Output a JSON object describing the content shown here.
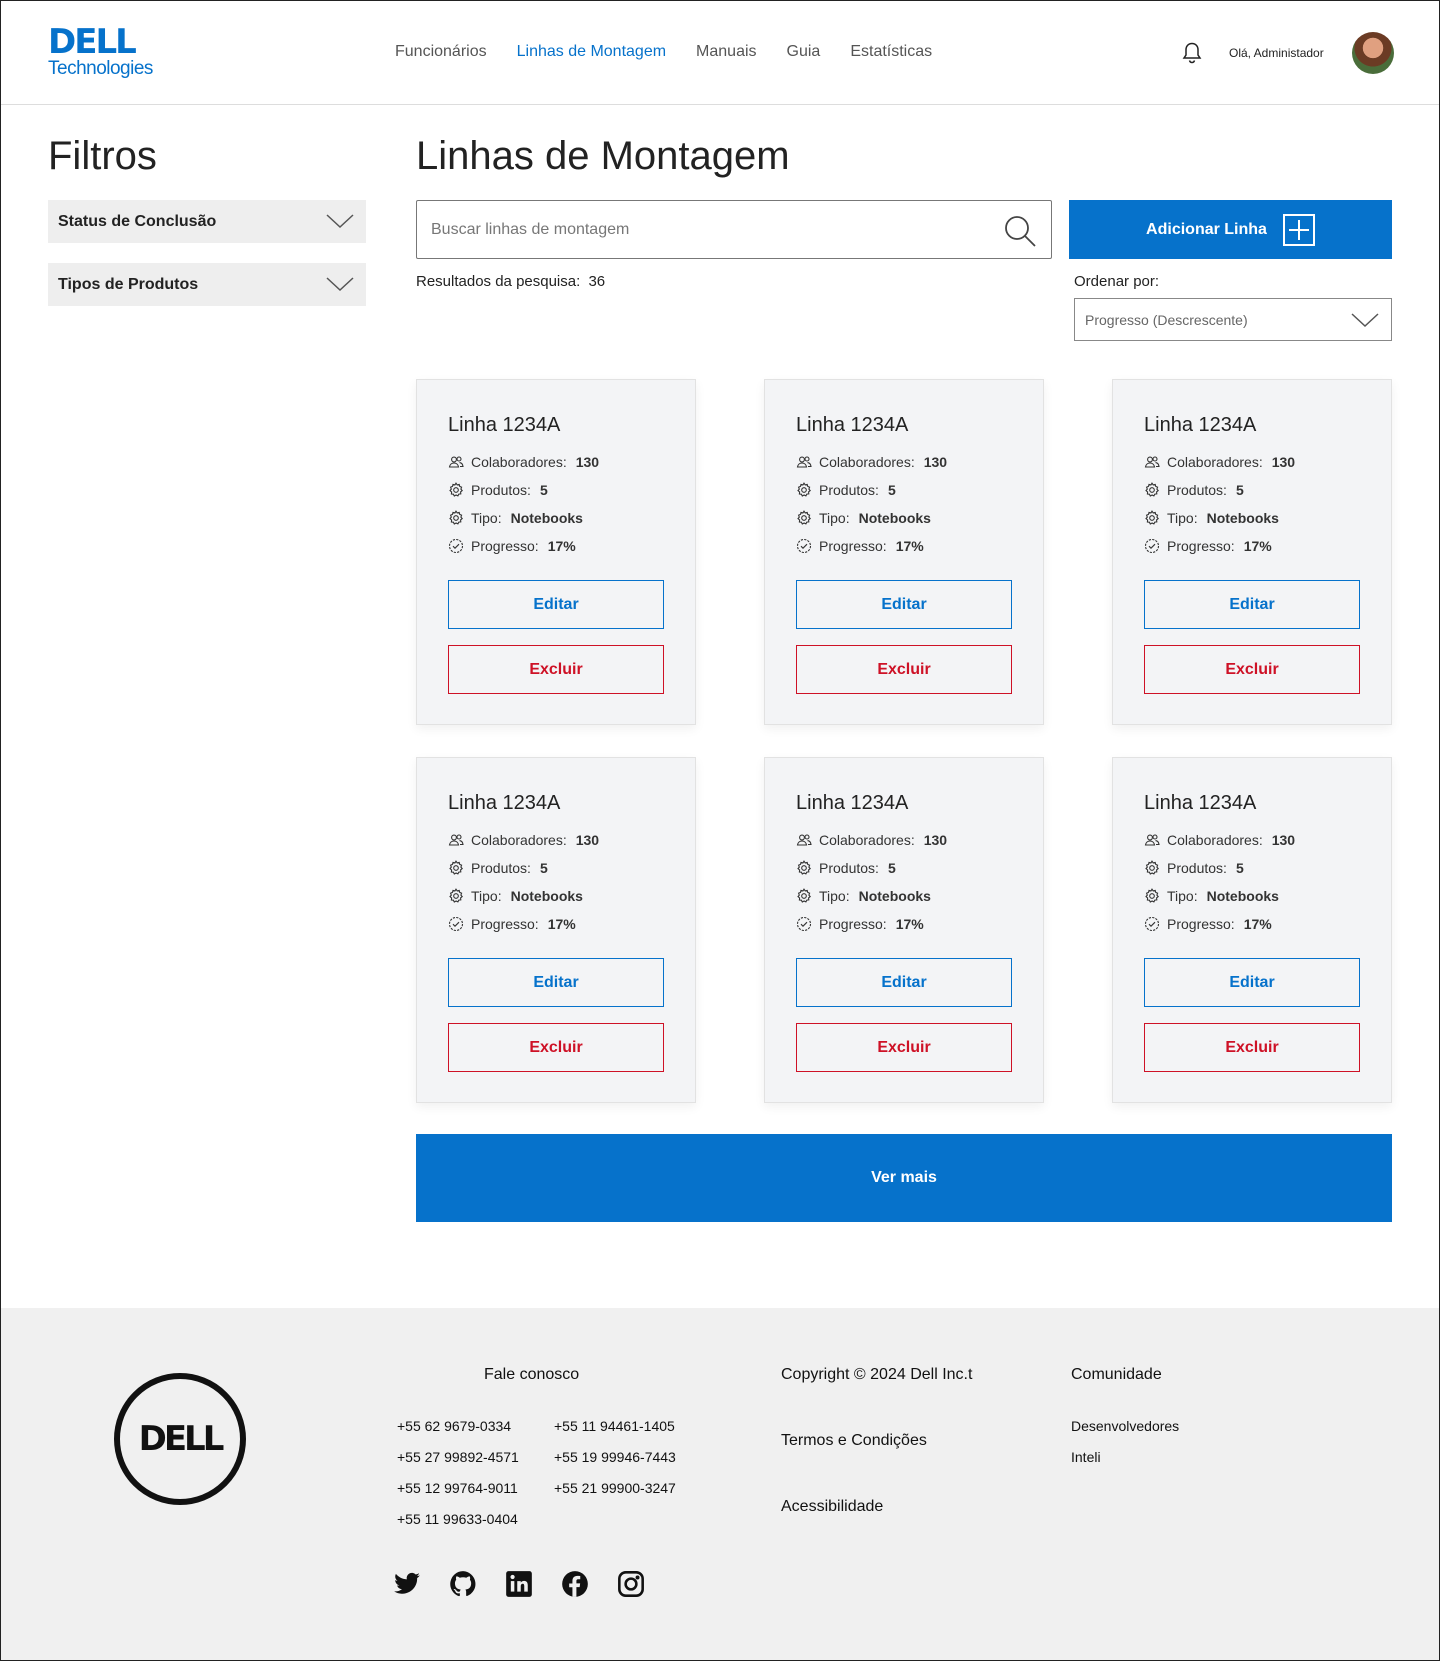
{
  "header": {
    "logo_main": "DELL",
    "logo_sub": "Technologies",
    "nav": [
      {
        "label": "Funcionários",
        "active": false
      },
      {
        "label": "Linhas de Montagem",
        "active": true
      },
      {
        "label": "Manuais",
        "active": false
      },
      {
        "label": "Guia",
        "active": false
      },
      {
        "label": "Estatísticas",
        "active": false
      }
    ],
    "greeting": "Olá, Administador"
  },
  "sidebar": {
    "title": "Filtros",
    "filters": [
      {
        "label": "Status de Conclusão"
      },
      {
        "label": "Tipos de Produtos"
      }
    ]
  },
  "main": {
    "title": "Linhas de Montagem",
    "search_placeholder": "Buscar linhas de montagem",
    "add_button": "Adicionar Linha",
    "results_label": "Resultados da pesquisa:",
    "results_count": "36",
    "sort_label": "Ordenar por:",
    "sort_value": "Progresso (Descrescente)",
    "more_button": "Ver mais"
  },
  "card_labels": {
    "collab": "Colaboradores:",
    "products": "Produtos:",
    "type": "Tipo:",
    "progress": "Progresso:",
    "edit": "Editar",
    "delete": "Excluir"
  },
  "cards": [
    {
      "title": "Linha 1234A",
      "collaborators": "130",
      "products": "5",
      "type": "Notebooks",
      "progress": "17%"
    },
    {
      "title": "Linha 1234A",
      "collaborators": "130",
      "products": "5",
      "type": "Notebooks",
      "progress": "17%"
    },
    {
      "title": "Linha 1234A",
      "collaborators": "130",
      "products": "5",
      "type": "Notebooks",
      "progress": "17%"
    },
    {
      "title": "Linha 1234A",
      "collaborators": "130",
      "products": "5",
      "type": "Notebooks",
      "progress": "17%"
    },
    {
      "title": "Linha 1234A",
      "collaborators": "130",
      "products": "5",
      "type": "Notebooks",
      "progress": "17%"
    },
    {
      "title": "Linha 1234A",
      "collaborators": "130",
      "products": "5",
      "type": "Notebooks",
      "progress": "17%"
    }
  ],
  "footer": {
    "logo_text": "DELL",
    "contact_title": "Fale conosco",
    "phones_col1": [
      "+55 62 9679-0334",
      "+55 27 99892-4571",
      "+55 12 99764-9011",
      "+55 11 99633-0404"
    ],
    "phones_col2": [
      "+55 11 94461-1405",
      "+55 19 99946-7443",
      "+55 21 99900-3247"
    ],
    "copyright": "Copyright © 2024 Dell Inc.t",
    "terms": "Termos e Condições",
    "accessibility": "Acessibilidade",
    "community_title": "Comunidade",
    "community_links": [
      "Desenvolvedores",
      "Inteli"
    ],
    "social": [
      "twitter-icon",
      "github-icon",
      "linkedin-icon",
      "facebook-icon",
      "instagram-icon"
    ]
  },
  "colors": {
    "accent": "#0672cb",
    "danger": "#ce1126",
    "card_bg": "#f3f4f6",
    "footer_bg": "#f0f0f0"
  }
}
